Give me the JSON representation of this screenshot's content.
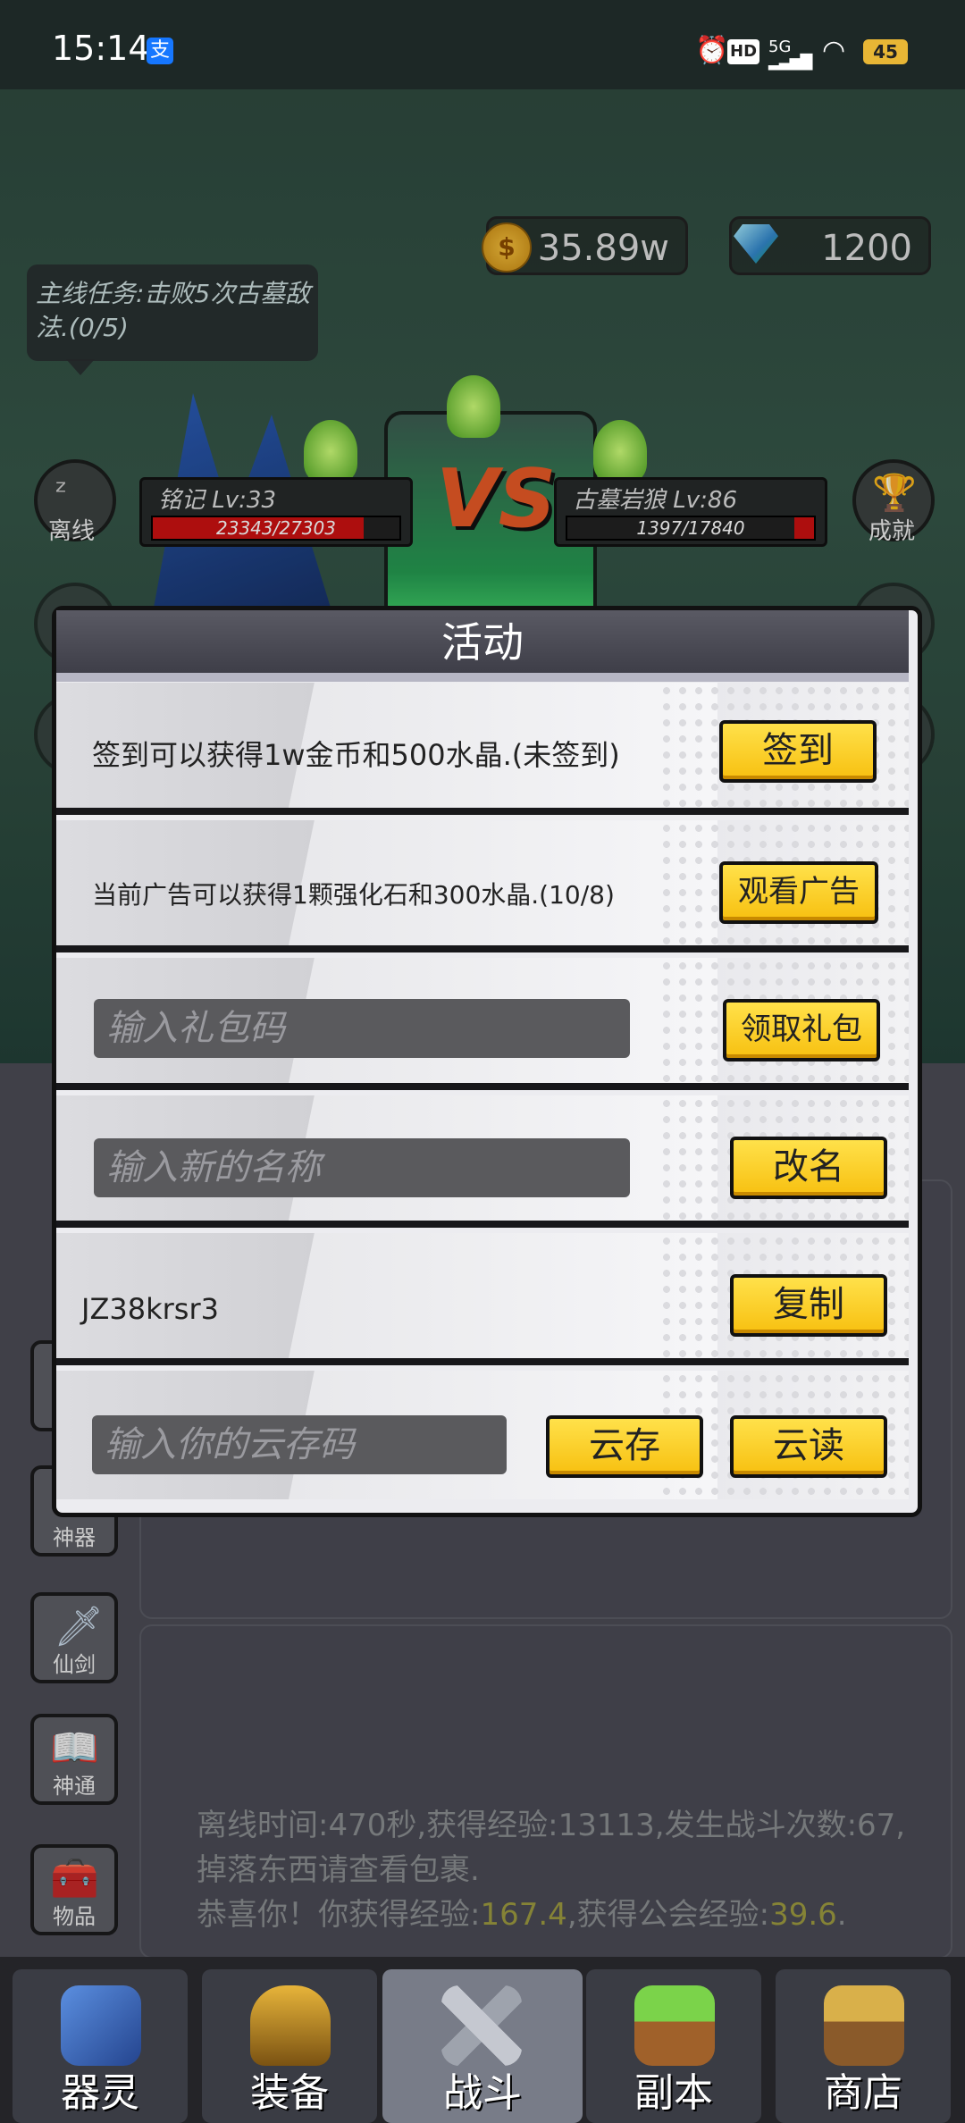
{
  "status_bar": {
    "time": "15:14",
    "alipay": "支",
    "hd": "HD",
    "network": "5G",
    "battery": "45"
  },
  "currency": {
    "gold": "35.89w",
    "crystals": "1200",
    "gold_symbol": "$"
  },
  "quest": {
    "text": "主线任务:击败5次古墓敌法.(0/5)"
  },
  "side_buttons": {
    "offline": "离线",
    "achievement": "成就"
  },
  "battle": {
    "player": {
      "name": "铭记 Lv:33",
      "hp": "23343/27303",
      "hp_ratio": 0.855
    },
    "enemy": {
      "name": "古墓岩狼 Lv:86",
      "hp": "1397/17840",
      "hp_ratio": 0.078
    },
    "vs": "VS"
  },
  "modal": {
    "title": "活动",
    "signin": {
      "text": "签到可以获得1w金币和500水晶.(未签到)",
      "button": "签到"
    },
    "ad": {
      "text": "当前广告可以获得1颗强化石和300水晶.(10/8)",
      "button": "观看广告"
    },
    "gift": {
      "placeholder": "输入礼包码",
      "button": "领取礼包"
    },
    "rename": {
      "placeholder": "输入新的名称",
      "button": "改名"
    },
    "code": {
      "text": "JZ38krsr3",
      "button": "复制"
    },
    "cloud": {
      "placeholder": "输入你的云存码",
      "save_button": "云存",
      "load_button": "云读"
    }
  },
  "left_menu": {
    "artifact": "神器",
    "sword": "仙剑",
    "tongue": "神通",
    "items": "物品"
  },
  "log": {
    "line1": "离线时间:470秒,获得经验:13113,发生战斗次数:67,掉落东西请查看包裹.",
    "line2_prefix": "恭喜你！你获得经验:",
    "exp": "167.4",
    "line2_mid": ",获得公会经验:",
    "guild_exp": "39.6",
    "line2_suffix": "."
  },
  "nav": {
    "spirit": "器灵",
    "equip": "装备",
    "battle": "战斗",
    "dungeon": "副本",
    "shop": "商店"
  },
  "colors": {
    "button_yellow": "#f7c010",
    "hp_red": "#cc1111",
    "highlight": "#9d9a40"
  }
}
